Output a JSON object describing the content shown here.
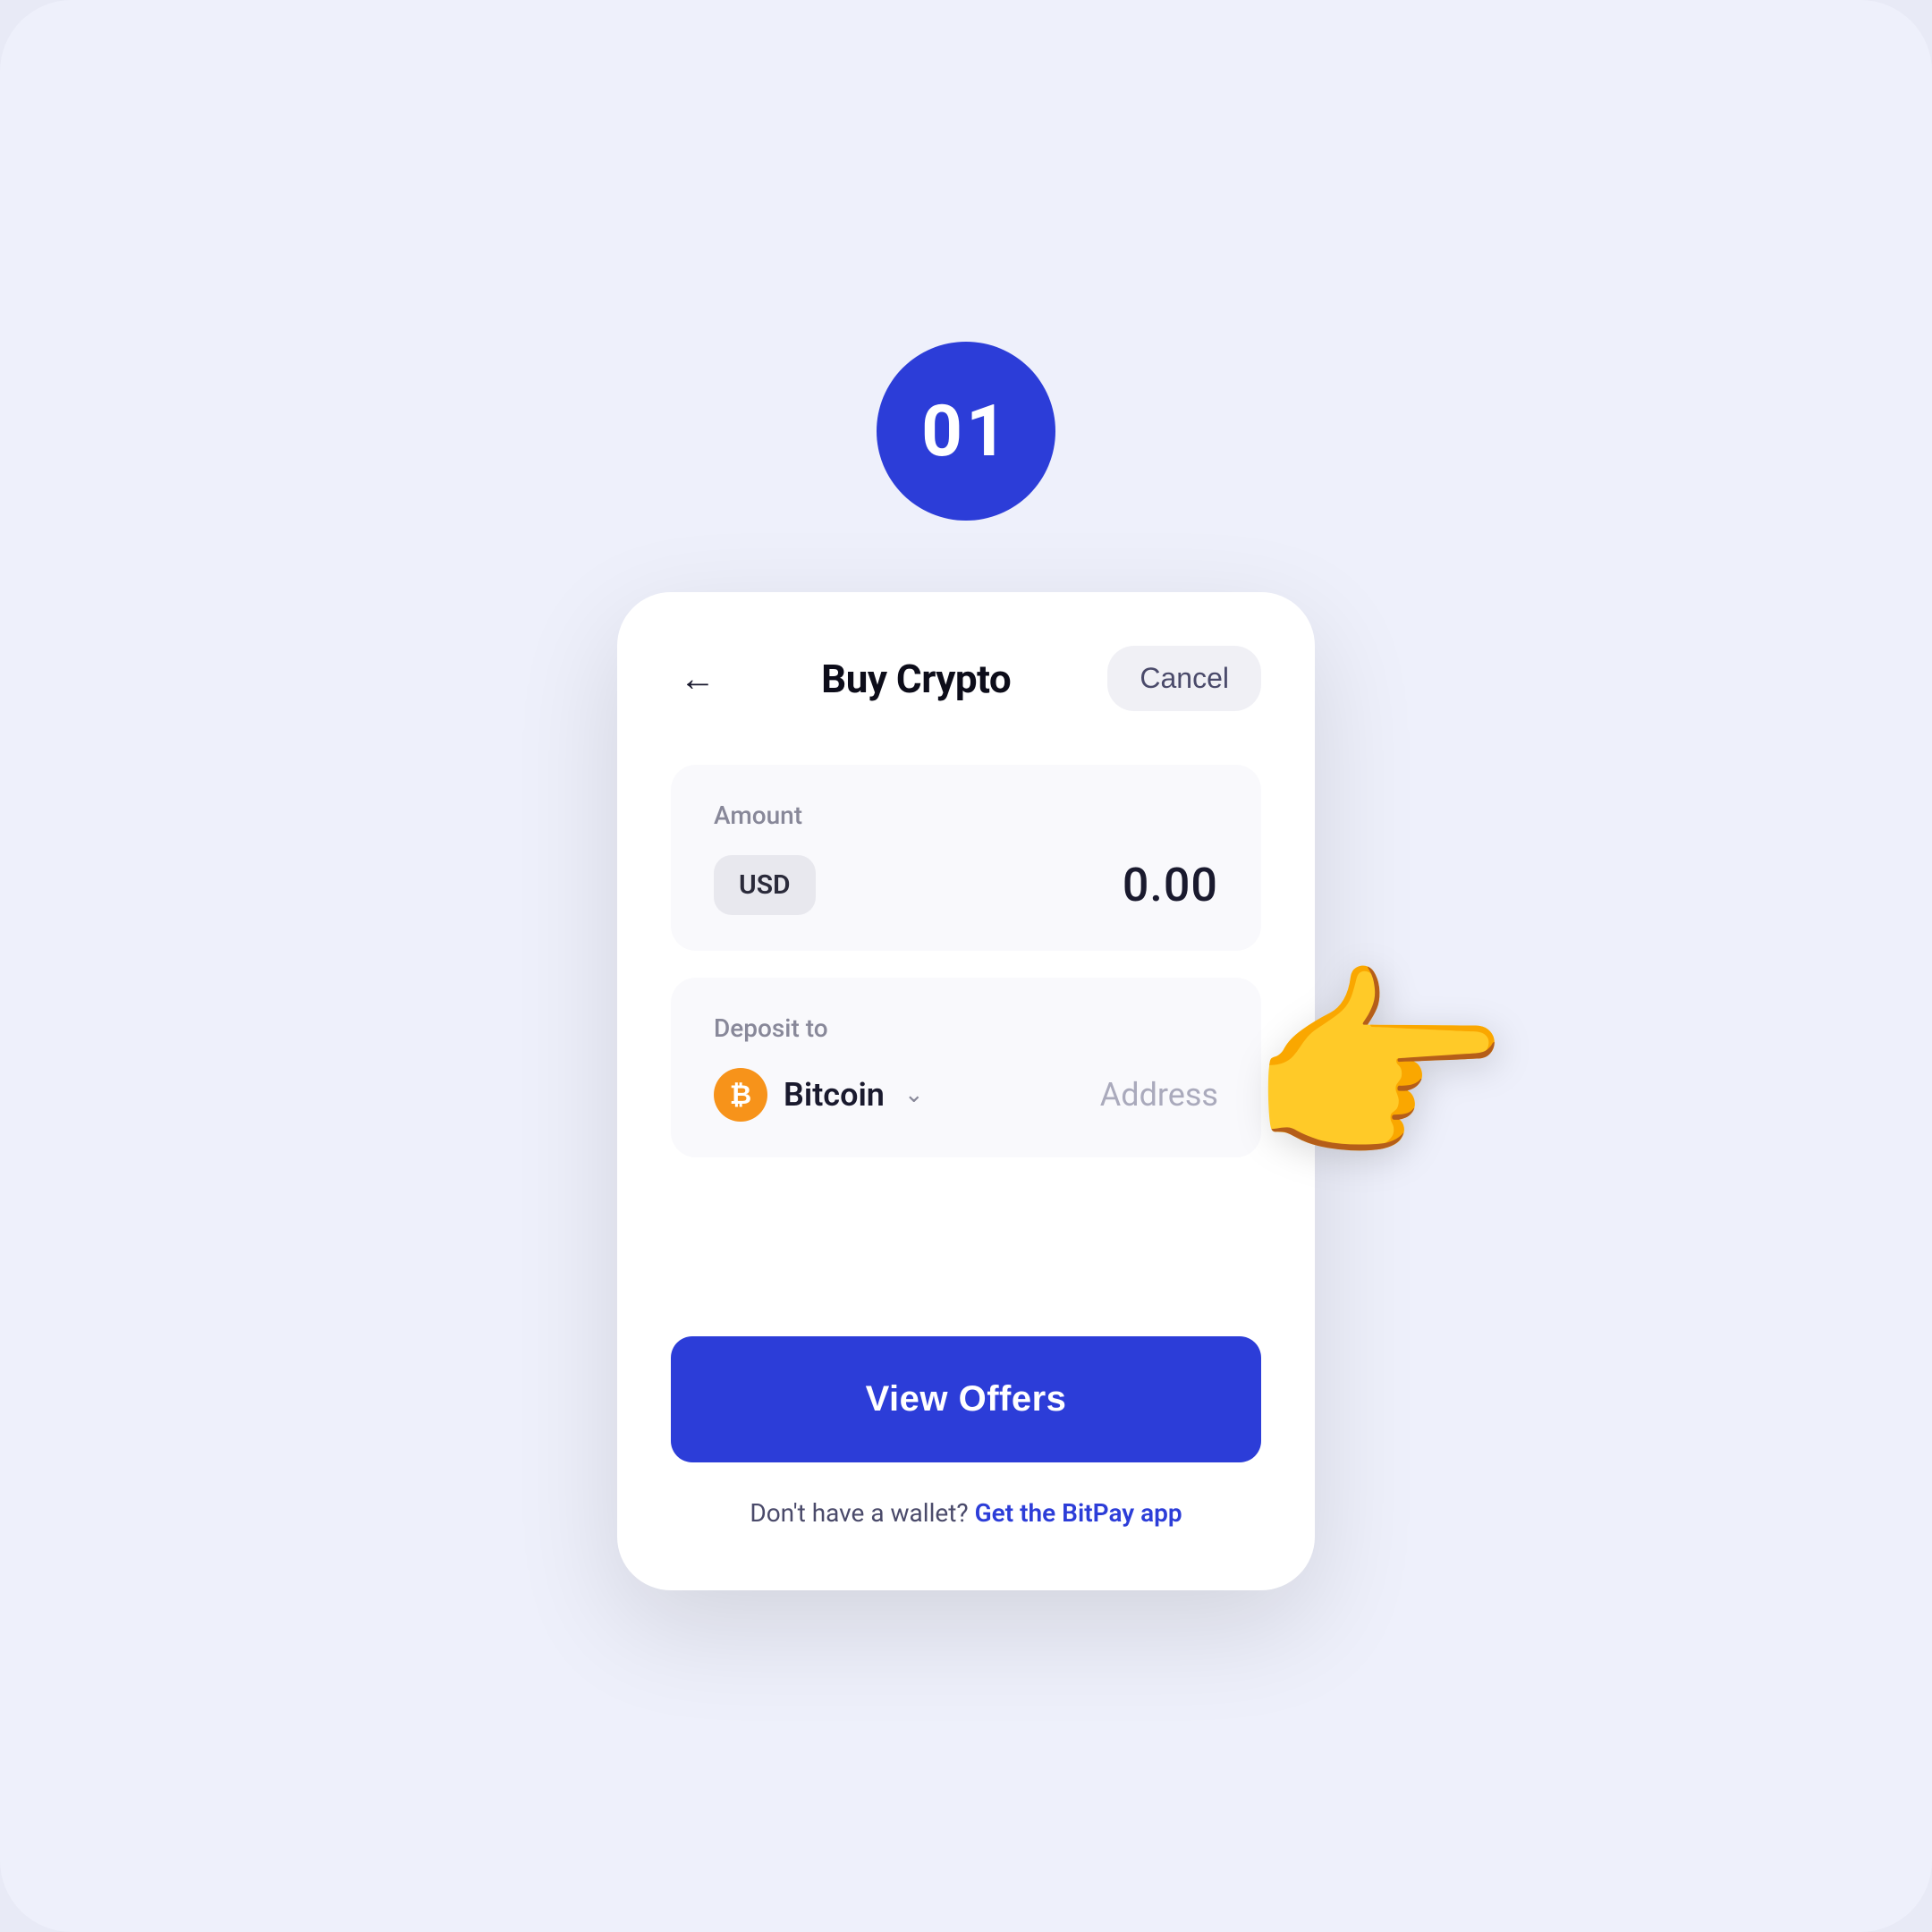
{
  "page": {
    "background_color": "#eef0fb",
    "step_number": "01"
  },
  "header": {
    "title": "Buy Crypto",
    "cancel_label": "Cancel",
    "back_icon": "←"
  },
  "amount_section": {
    "label": "Amount",
    "currency": "USD",
    "value": "0.00"
  },
  "deposit_section": {
    "label": "Deposit to",
    "crypto_name": "Bitcoin",
    "address_placeholder": "Address",
    "chevron": "∨"
  },
  "actions": {
    "view_offers_label": "View Offers"
  },
  "footer": {
    "no_wallet_text": "Don't have a wallet?",
    "get_app_link": "Get the BitPay app"
  }
}
